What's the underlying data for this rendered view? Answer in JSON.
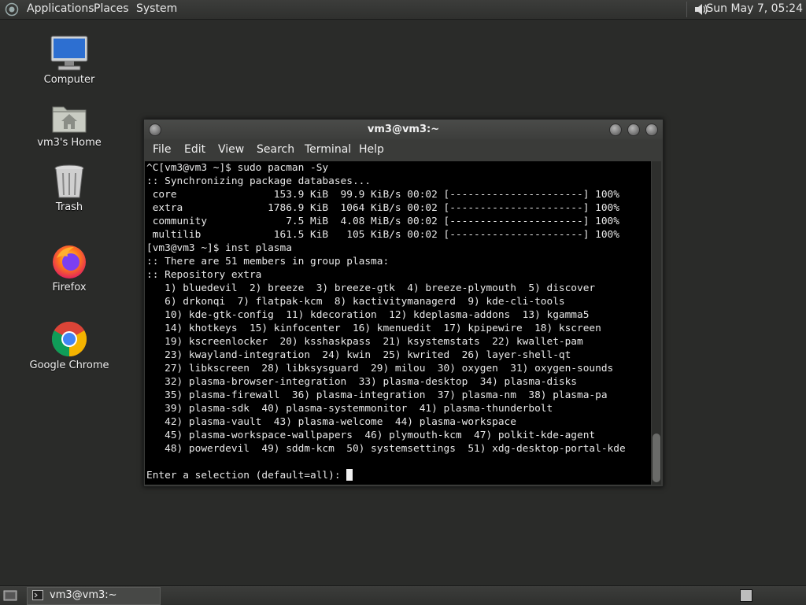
{
  "top_panel": {
    "menus": [
      "Applications",
      "Places",
      "System"
    ],
    "clock": "Sun May  7, 05:24",
    "volume_icon": "speaker-icon"
  },
  "desktop_icons": [
    {
      "label": "Computer",
      "icon": "computer-icon"
    },
    {
      "label": "vm3's Home",
      "icon": "home-folder-icon"
    },
    {
      "label": "Trash",
      "icon": "trash-icon"
    },
    {
      "label": "Firefox",
      "icon": "firefox-icon"
    },
    {
      "label": "Google Chrome",
      "icon": "chrome-icon"
    }
  ],
  "terminal_window": {
    "title": "vm3@vm3:~",
    "menu": [
      "File",
      "Edit",
      "View",
      "Search",
      "Terminal",
      "Help"
    ],
    "lines": [
      "^C[vm3@vm3 ~]$ sudo pacman -Sy",
      ":: Synchronizing package databases...",
      " core                153.9 KiB  99.9 KiB/s 00:02 [----------------------] 100%",
      " extra              1786.9 KiB  1064 KiB/s 00:02 [----------------------] 100%",
      " community             7.5 MiB  4.08 MiB/s 00:02 [----------------------] 100%",
      " multilib            161.5 KiB   105 KiB/s 00:02 [----------------------] 100%",
      "[vm3@vm3 ~]$ inst plasma",
      ":: There are 51 members in group plasma:",
      ":: Repository extra",
      "   1) bluedevil  2) breeze  3) breeze-gtk  4) breeze-plymouth  5) discover",
      "   6) drkonqi  7) flatpak-kcm  8) kactivitymanagerd  9) kde-cli-tools",
      "   10) kde-gtk-config  11) kdecoration  12) kdeplasma-addons  13) kgamma5",
      "   14) khotkeys  15) kinfocenter  16) kmenuedit  17) kpipewire  18) kscreen",
      "   19) kscreenlocker  20) ksshaskpass  21) ksystemstats  22) kwallet-pam",
      "   23) kwayland-integration  24) kwin  25) kwrited  26) layer-shell-qt",
      "   27) libkscreen  28) libksysguard  29) milou  30) oxygen  31) oxygen-sounds",
      "   32) plasma-browser-integration  33) plasma-desktop  34) plasma-disks",
      "   35) plasma-firewall  36) plasma-integration  37) plasma-nm  38) plasma-pa",
      "   39) plasma-sdk  40) plasma-systemmonitor  41) plasma-thunderbolt",
      "   42) plasma-vault  43) plasma-welcome  44) plasma-workspace",
      "   45) plasma-workspace-wallpapers  46) plymouth-kcm  47) polkit-kde-agent",
      "   48) powerdevil  49) sddm-kcm  50) systemsettings  51) xdg-desktop-portal-kde",
      ""
    ],
    "prompt": "Enter a selection (default=all): "
  },
  "bottom_panel": {
    "task_label": "vm3@vm3:~"
  }
}
